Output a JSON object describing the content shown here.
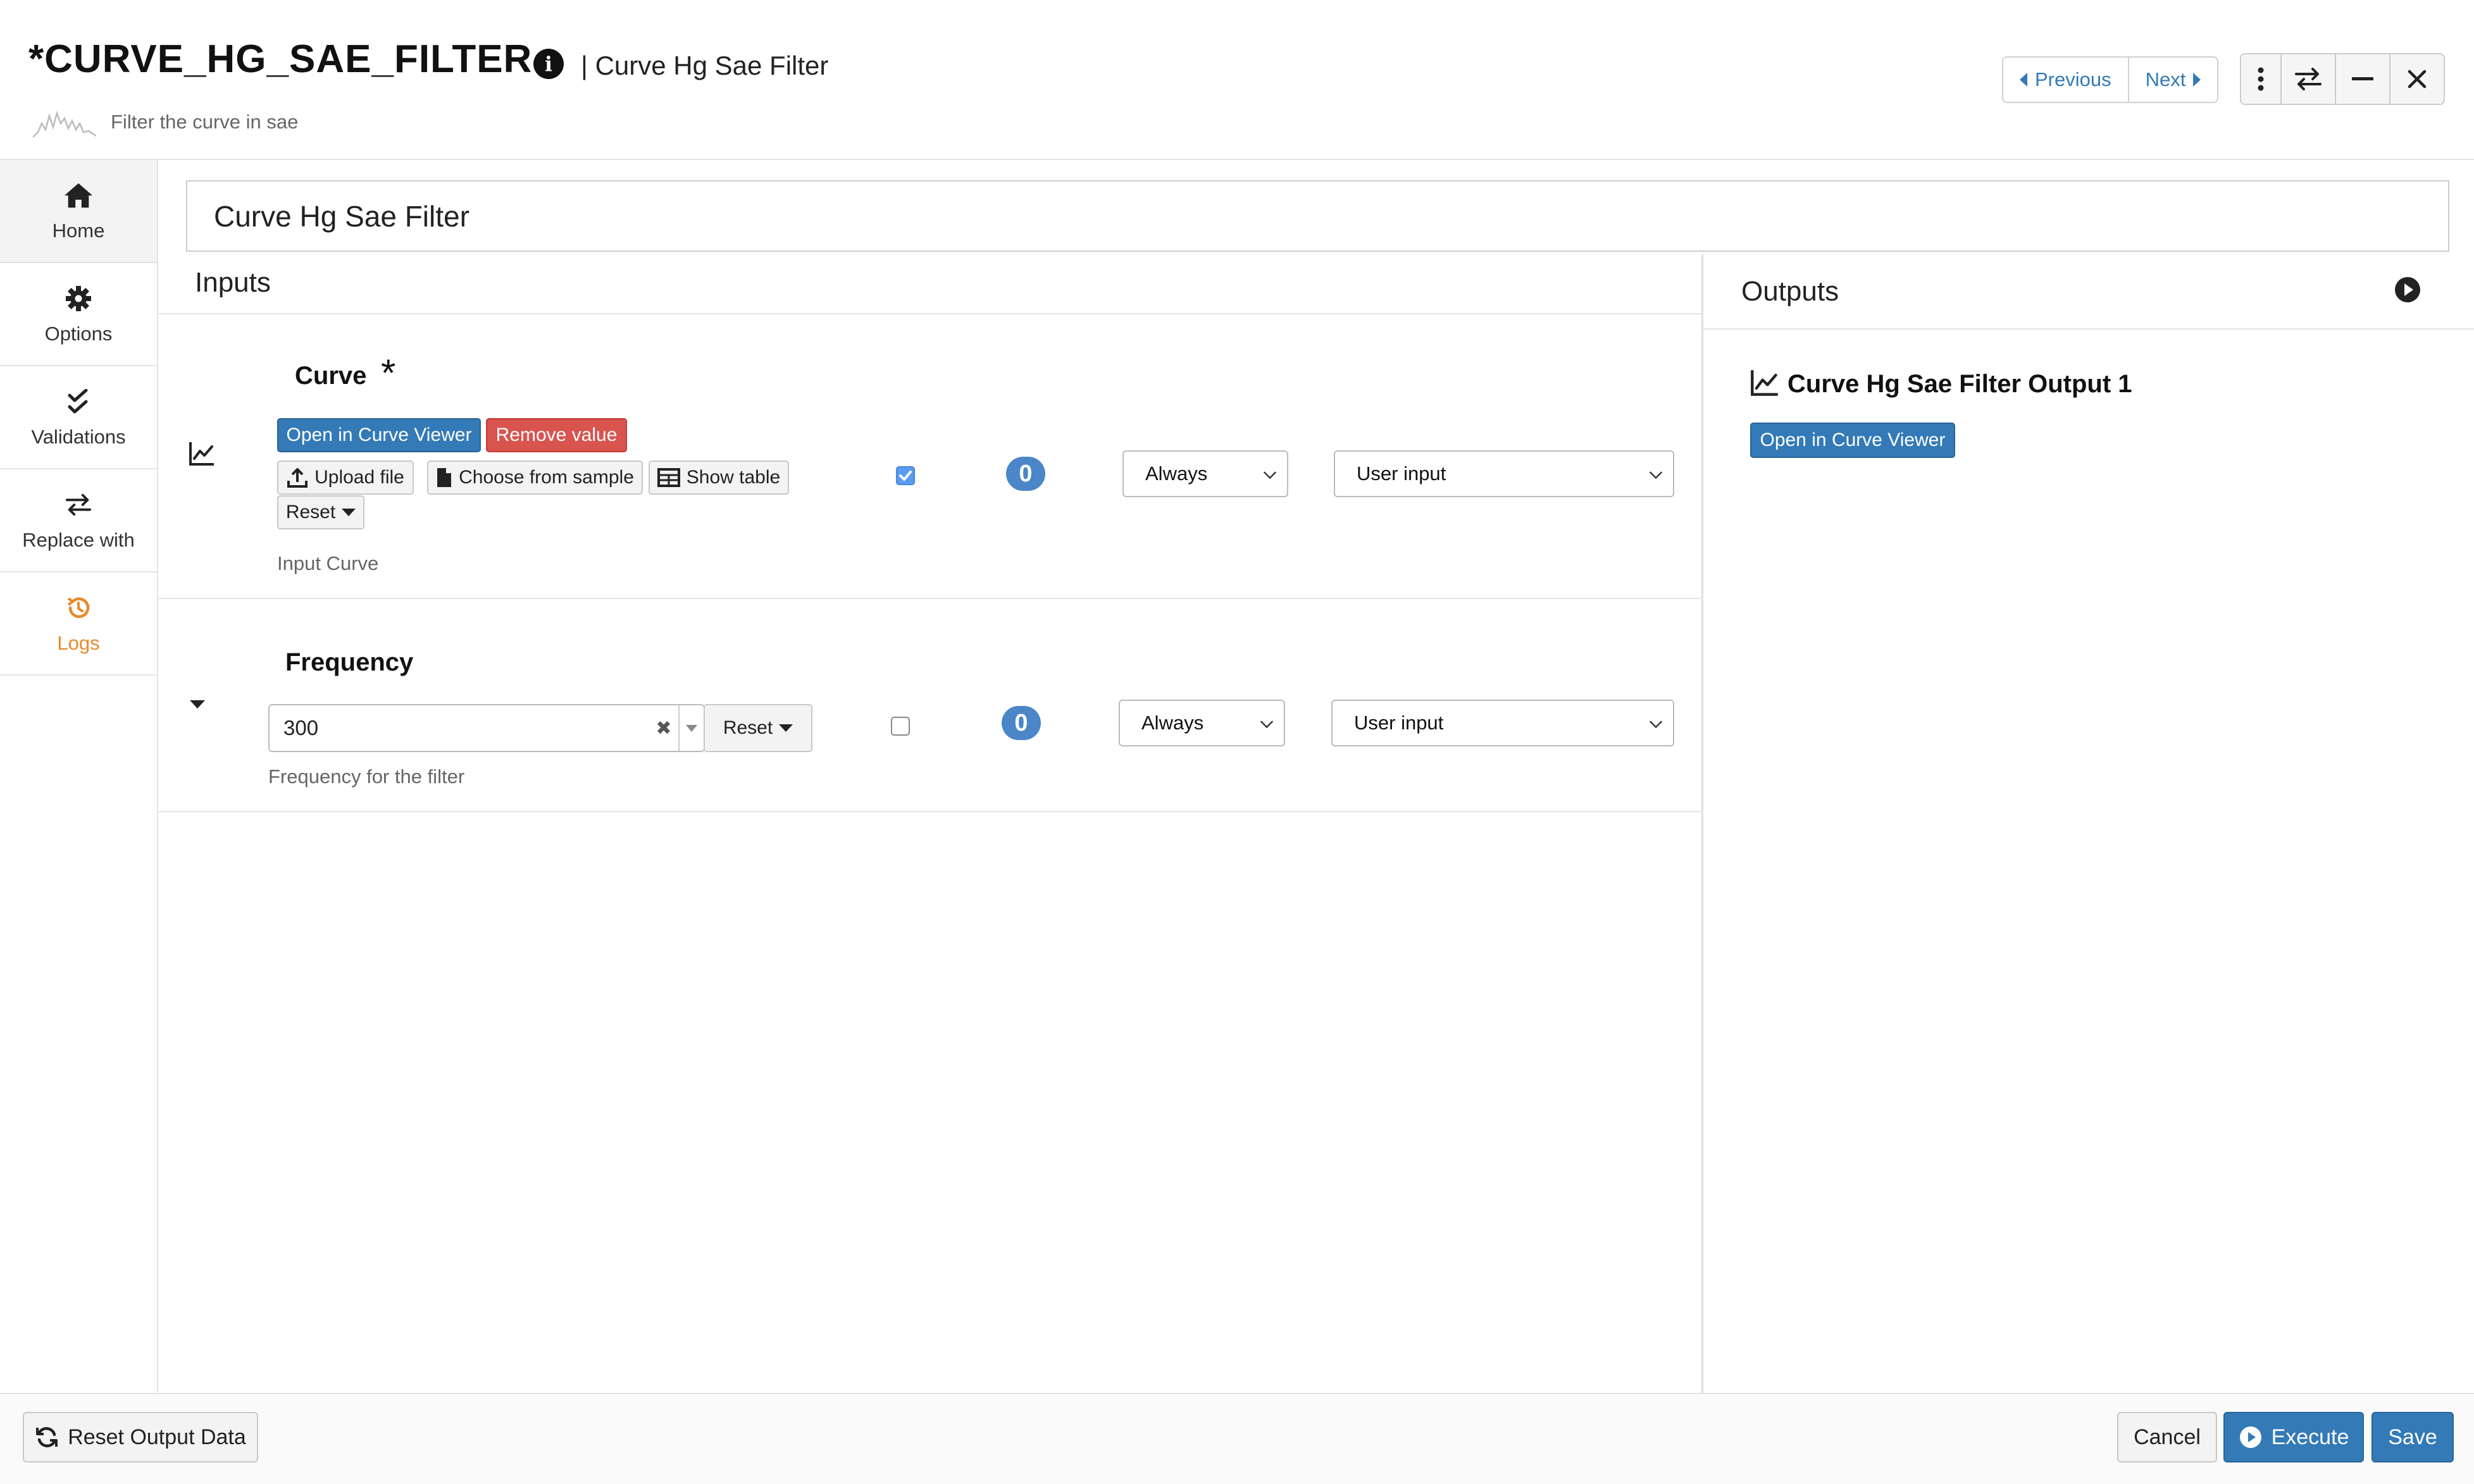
{
  "header": {
    "title": "*CURVE_HG_SAE_FILTER",
    "subtitle": "| Curve Hg Sae Filter",
    "description": "Filter the curve in sae",
    "nav": {
      "previous": "Previous",
      "next": "Next"
    }
  },
  "sidebar": {
    "items": [
      {
        "label": "Home",
        "icon": "home-icon"
      },
      {
        "label": "Options",
        "icon": "gear-icon"
      },
      {
        "label": "Validations",
        "icon": "check-double-icon"
      },
      {
        "label": "Replace with",
        "icon": "exchange-icon"
      },
      {
        "label": "Logs",
        "icon": "history-icon"
      }
    ]
  },
  "main": {
    "name_value": "Curve Hg Sae Filter",
    "inputs_title": "Inputs",
    "outputs_title": "Outputs"
  },
  "inputs": {
    "curve": {
      "label": "Curve",
      "required_mark": "*",
      "open_viewer": "Open in Curve Viewer",
      "remove_value": "Remove value",
      "upload_file": "Upload file",
      "choose_sample": "Choose from sample",
      "show_table": "Show table",
      "reset": "Reset",
      "description": "Input Curve",
      "badge": "0",
      "condition": "Always",
      "source": "User input",
      "checked": true
    },
    "frequency": {
      "label": "Frequency",
      "value": "300",
      "reset": "Reset",
      "description": "Frequency for the filter",
      "badge": "0",
      "condition": "Always",
      "source": "User input",
      "checked": false
    }
  },
  "outputs": {
    "item_title": "Curve Hg Sae Filter Output 1",
    "open_viewer": "Open in Curve Viewer"
  },
  "footer": {
    "reset_output": "Reset Output Data",
    "cancel": "Cancel",
    "execute": "Execute",
    "save": "Save"
  },
  "colors": {
    "primary": "#337ab7",
    "danger": "#d9534f",
    "logs_accent": "#e8892a",
    "badge": "#4a86c8"
  }
}
